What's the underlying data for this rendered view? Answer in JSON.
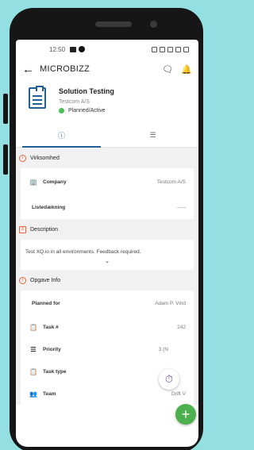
{
  "status_bar": {
    "time": "12:50"
  },
  "appbar": {
    "title": "MICROBIZZ"
  },
  "header": {
    "title": "Solution Testing",
    "company": "Testcom A/S",
    "status": "Planned/Active",
    "status_color": "#4cbf59"
  },
  "tabs": [
    {
      "icon": "info-icon"
    },
    {
      "icon": "list-icon"
    }
  ],
  "sections": {
    "virksomhed": {
      "title": "Virksomhed",
      "rows": [
        {
          "label": "Company",
          "value": "Testcom A/S"
        },
        {
          "label": "Listedækning",
          "value": "-----"
        }
      ]
    },
    "description": {
      "title": "Description",
      "text": "Test XQ.io in all environments. Feedback required."
    },
    "opgave": {
      "title": "Opgave Info",
      "rows": [
        {
          "label": "Planned for",
          "value": "Adam P. Vind"
        },
        {
          "label": "Task #",
          "value": "242"
        },
        {
          "label": "Priority",
          "value": "3 (N"
        },
        {
          "label": "Task type",
          "value": "A"
        },
        {
          "label": "Team",
          "value": "Drift V"
        }
      ]
    }
  },
  "colors": {
    "accent": "#1f5f9a",
    "section_icon": "#e8643a",
    "fab_add": "#4cb04e",
    "background": "#93dfe2"
  }
}
